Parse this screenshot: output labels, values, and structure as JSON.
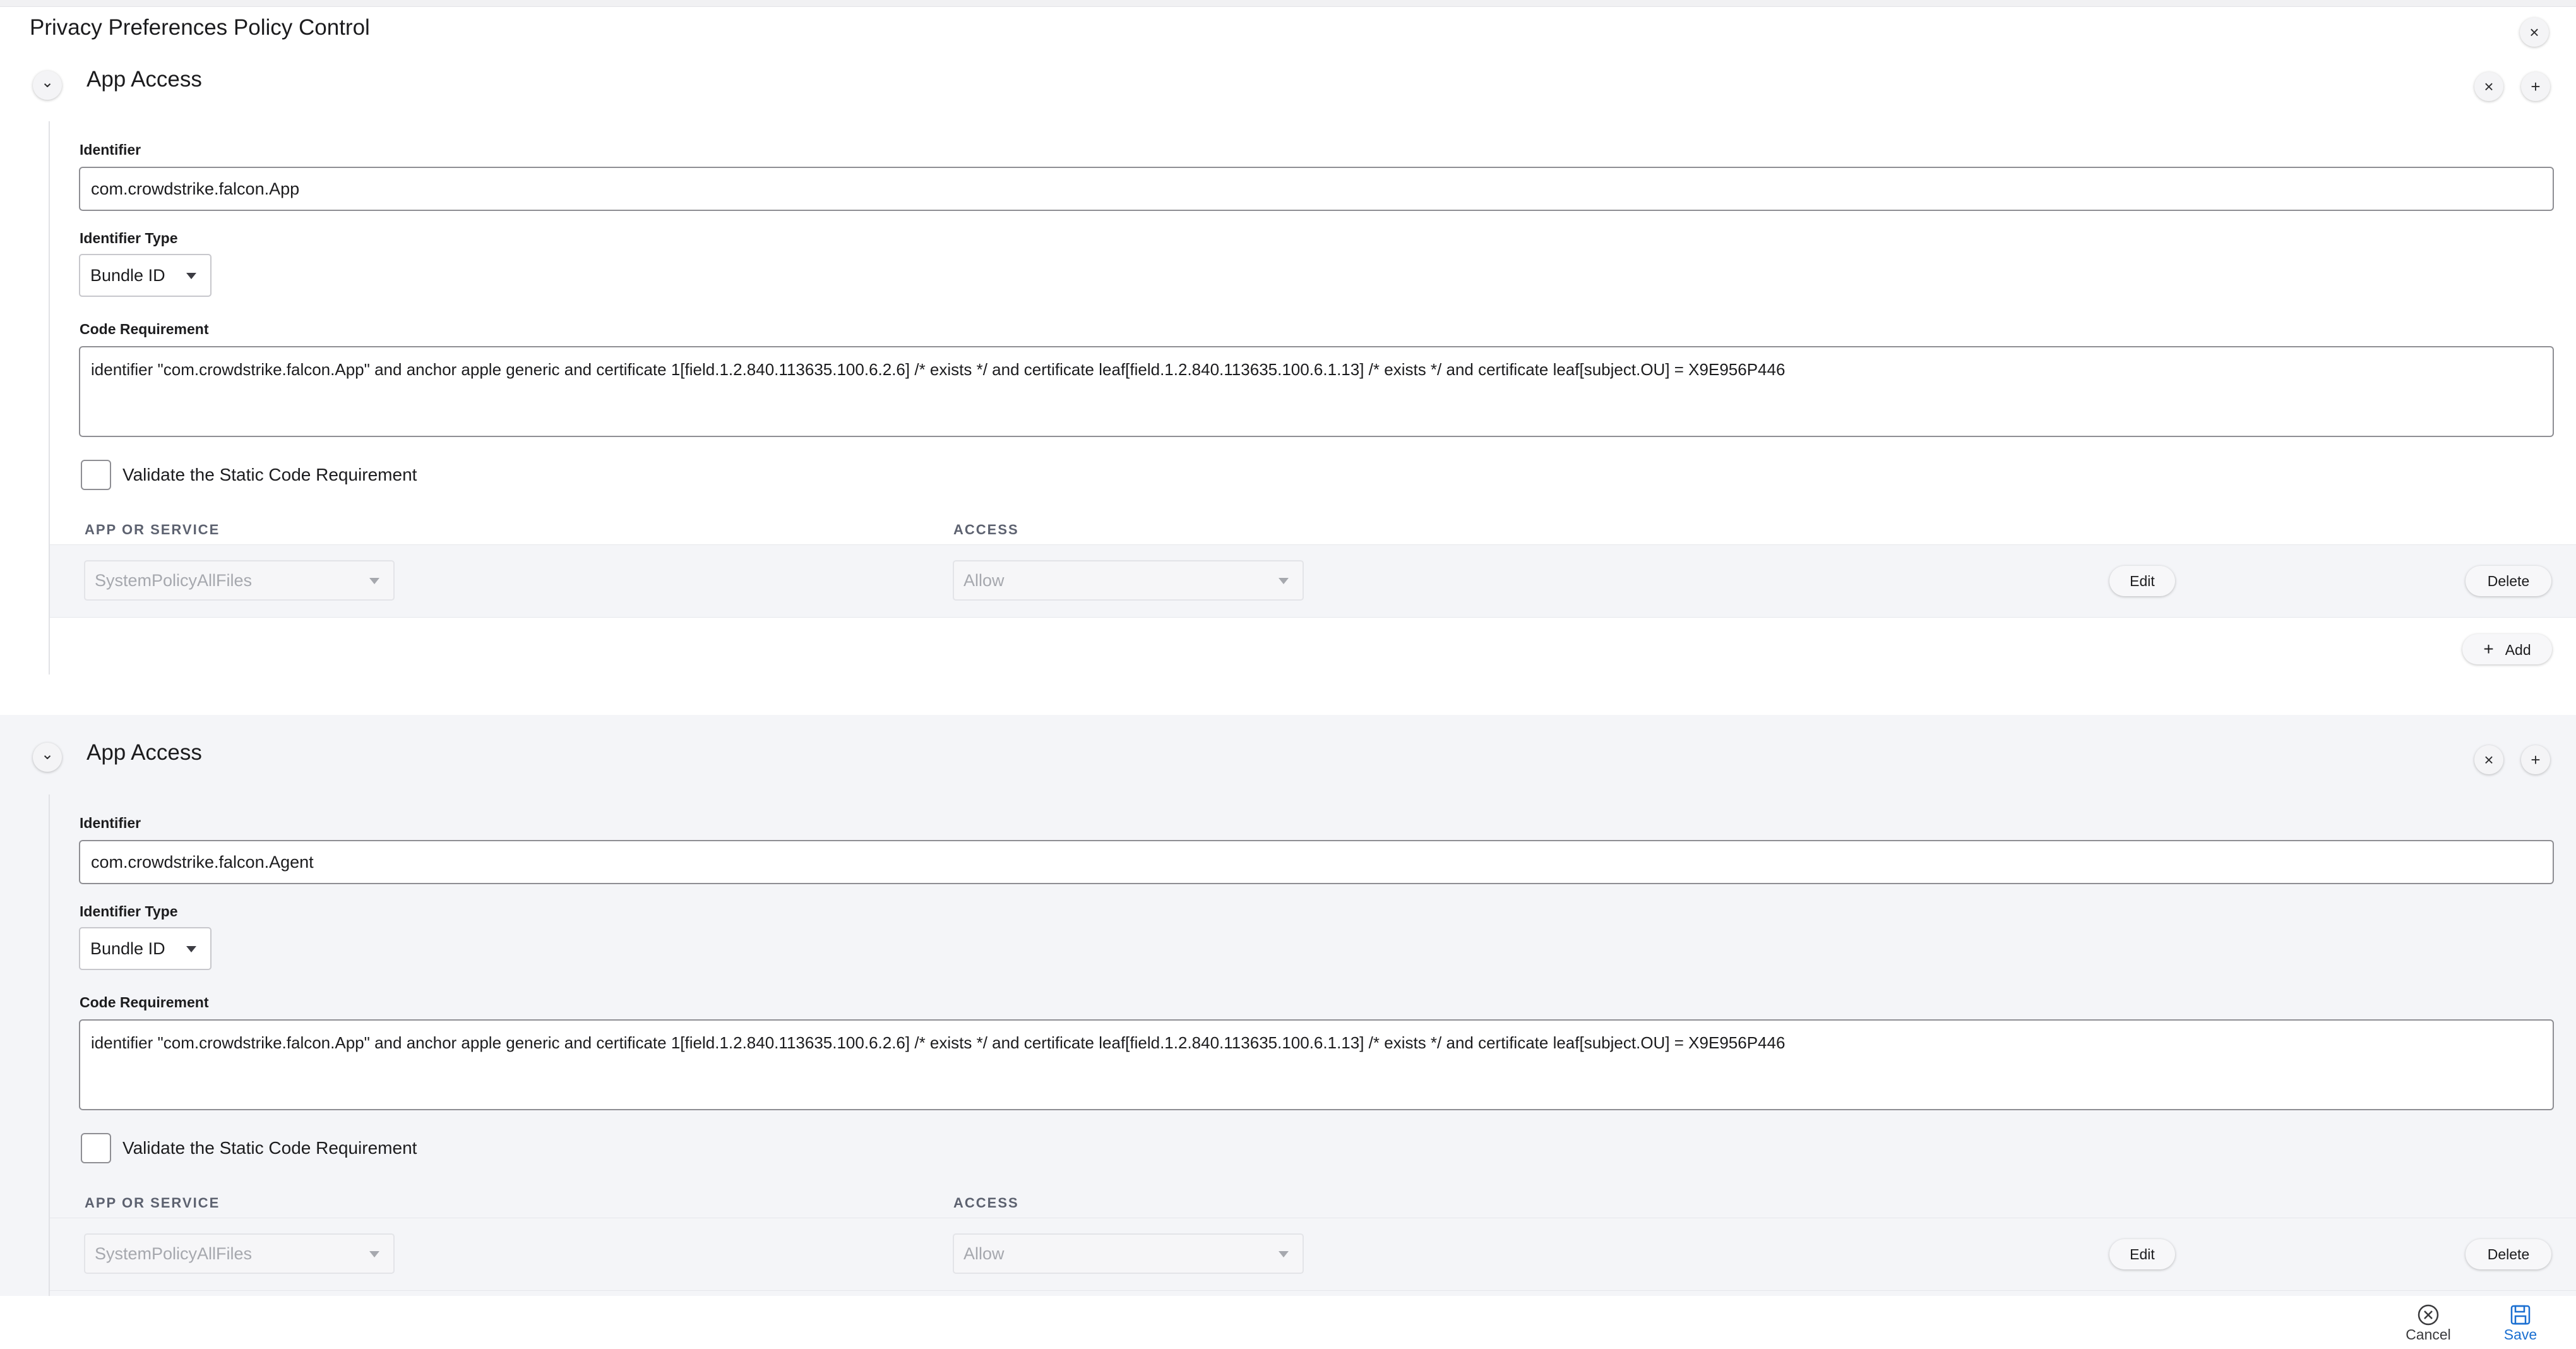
{
  "page": {
    "title": "Privacy Preferences Policy Control",
    "close_symbol": "×"
  },
  "sections": [
    {
      "title": "App Access",
      "remove_symbol": "×",
      "add_symbol": "+",
      "chevron": "⌄",
      "identifier_label": "Identifier",
      "identifier_value": "com.crowdstrike.falcon.App",
      "identifier_type_label": "Identifier Type",
      "identifier_type_value": "Bundle ID",
      "code_requirement_label": "Code Requirement",
      "code_requirement_value": "identifier \"com.crowdstrike.falcon.App\" and anchor apple generic and certificate 1[field.1.2.840.113635.100.6.2.6] /* exists */ and certificate leaf[field.1.2.840.113635.100.6.1.13] /* exists */ and certificate leaf[subject.OU] = X9E956P446",
      "validate_label": "Validate the Static Code Requirement",
      "validate_checked": false,
      "col_app": "APP OR SERVICE",
      "col_access": "ACCESS",
      "rows": [
        {
          "service": "SystemPolicyAllFiles",
          "access": "Allow",
          "edit_label": "Edit",
          "delete_label": "Delete"
        }
      ],
      "add_icon": "+",
      "add_label": "Add"
    },
    {
      "title": "App Access",
      "remove_symbol": "×",
      "add_symbol": "+",
      "chevron": "⌄",
      "identifier_label": "Identifier",
      "identifier_value": "com.crowdstrike.falcon.Agent",
      "identifier_type_label": "Identifier Type",
      "identifier_type_value": "Bundle ID",
      "code_requirement_label": "Code Requirement",
      "code_requirement_value": "identifier \"com.crowdstrike.falcon.App\" and anchor apple generic and certificate 1[field.1.2.840.113635.100.6.2.6] /* exists */ and certificate leaf[field.1.2.840.113635.100.6.1.13] /* exists */ and certificate leaf[subject.OU] = X9E956P446",
      "validate_label": "Validate the Static Code Requirement",
      "validate_checked": false,
      "col_app": "APP OR SERVICE",
      "col_access": "ACCESS",
      "rows": [
        {
          "service": "SystemPolicyAllFiles",
          "access": "Allow",
          "edit_label": "Edit",
          "delete_label": "Delete"
        }
      ]
    }
  ],
  "footer": {
    "cancel_label": "Cancel",
    "save_label": "Save",
    "accent_color": "#1a6fd1"
  }
}
